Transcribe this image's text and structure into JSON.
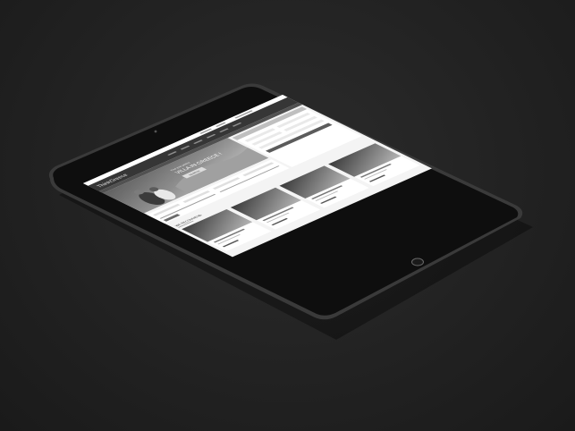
{
  "site": {
    "logo": "ThinkGreece",
    "hero_title": "VILLA IN GREECE !",
    "hero_subtitle": "Find your perfect",
    "hero_button": "SEARCH",
    "section_title": "WE RECOMMEND"
  },
  "colors": {
    "background": "#222222",
    "device_frame": "#0e0e0e",
    "device_rim": "#3a3a3a",
    "screen_bg": "#f4f4f4",
    "nav_bar": "#2e2e2e",
    "hero_dark": "#3d3d3d"
  },
  "icons": {
    "home_button": "home-button-icon",
    "camera": "front-camera-icon"
  }
}
